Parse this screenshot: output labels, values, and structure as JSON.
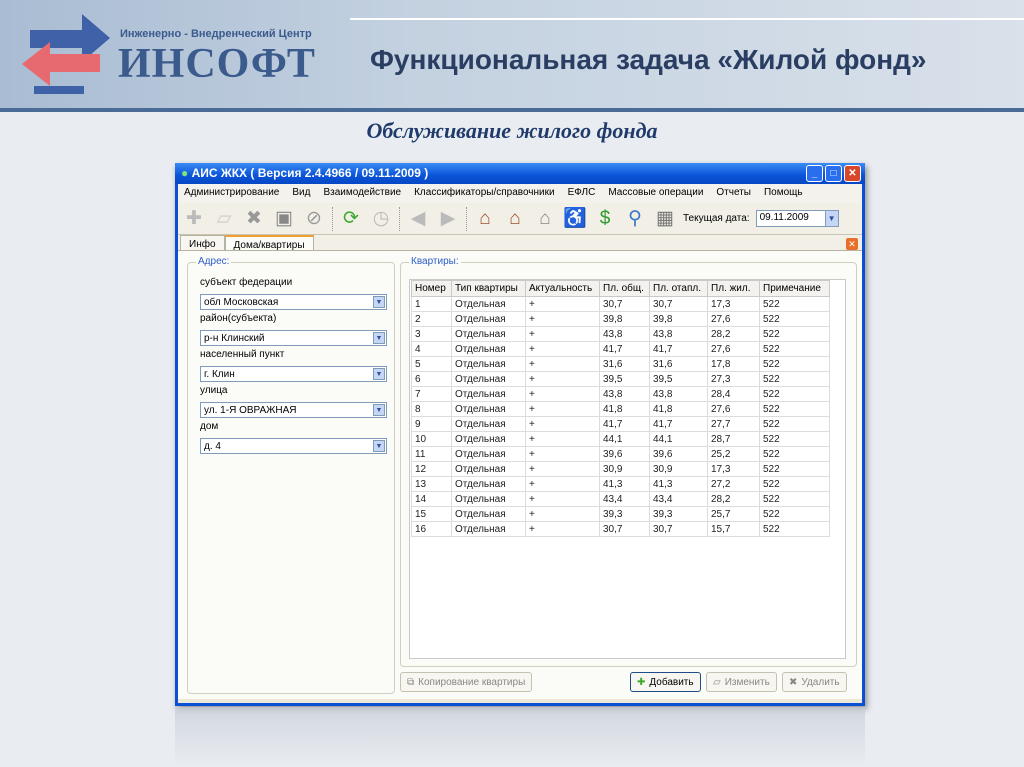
{
  "slide": {
    "logo_subtitle": "Инженерно - Внедренческий Центр",
    "logo_name": "ИНСОФТ",
    "title": "Функциональная задача «Жилой фонд»",
    "subtitle": "Обслуживание жилого фонда"
  },
  "window": {
    "title": "АИС ЖКХ ( Версия 2.4.4966 / 09.11.2009 )",
    "menu": [
      "Администрирование",
      "Вид",
      "Взаимодействие",
      "Классификаторы/справочники",
      "ЕФЛС",
      "Массовые операции",
      "Отчеты",
      "Помощь"
    ],
    "current_date_label": "Текущая дата:",
    "current_date": "09.11.2009",
    "tabs": [
      "Инфо",
      "Дома/квартиры"
    ]
  },
  "address": {
    "legend": "Адрес:",
    "fields": [
      {
        "label": "субъект федерации",
        "value": "обл Московская"
      },
      {
        "label": "район(субъекта)",
        "value": "р-н Клинский"
      },
      {
        "label": "населенный пункт",
        "value": "г. Клин"
      },
      {
        "label": "улица",
        "value": "ул. 1-Я ОВРАЖНАЯ"
      },
      {
        "label": "дом",
        "value": "д. 4"
      }
    ]
  },
  "apartments": {
    "legend": "Квартиры:",
    "columns": [
      "Номер",
      "Тип квартиры",
      "Актуальность",
      "Пл. общ.",
      "Пл. отапл.",
      "Пл. жил.",
      "Примечание"
    ],
    "rows": [
      [
        "1",
        "Отдельная",
        "+",
        "30,7",
        "30,7",
        "17,3",
        "522"
      ],
      [
        "2",
        "Отдельная",
        "+",
        "39,8",
        "39,8",
        "27,6",
        "522"
      ],
      [
        "3",
        "Отдельная",
        "+",
        "43,8",
        "43,8",
        "28,2",
        "522"
      ],
      [
        "4",
        "Отдельная",
        "+",
        "41,7",
        "41,7",
        "27,6",
        "522"
      ],
      [
        "5",
        "Отдельная",
        "+",
        "31,6",
        "31,6",
        "17,8",
        "522"
      ],
      [
        "6",
        "Отдельная",
        "+",
        "39,5",
        "39,5",
        "27,3",
        "522"
      ],
      [
        "7",
        "Отдельная",
        "+",
        "43,8",
        "43,8",
        "28,4",
        "522"
      ],
      [
        "8",
        "Отдельная",
        "+",
        "41,8",
        "41,8",
        "27,6",
        "522"
      ],
      [
        "9",
        "Отдельная",
        "+",
        "41,7",
        "41,7",
        "27,7",
        "522"
      ],
      [
        "10",
        "Отдельная",
        "+",
        "44,1",
        "44,1",
        "28,7",
        "522"
      ],
      [
        "11",
        "Отдельная",
        "+",
        "39,6",
        "39,6",
        "25,2",
        "522"
      ],
      [
        "12",
        "Отдельная",
        "+",
        "30,9",
        "30,9",
        "17,3",
        "522"
      ],
      [
        "13",
        "Отдельная",
        "+",
        "41,3",
        "41,3",
        "27,2",
        "522"
      ],
      [
        "14",
        "Отдельная",
        "+",
        "43,4",
        "43,4",
        "28,2",
        "522"
      ],
      [
        "15",
        "Отдельная",
        "+",
        "39,3",
        "39,3",
        "25,7",
        "522"
      ],
      [
        "16",
        "Отдельная",
        "+",
        "30,7",
        "30,7",
        "15,7",
        "522"
      ]
    ]
  },
  "buttons": {
    "copy": "Копирование квартиры",
    "add": "Добавить",
    "edit": "Изменить",
    "delete": "Удалить"
  }
}
